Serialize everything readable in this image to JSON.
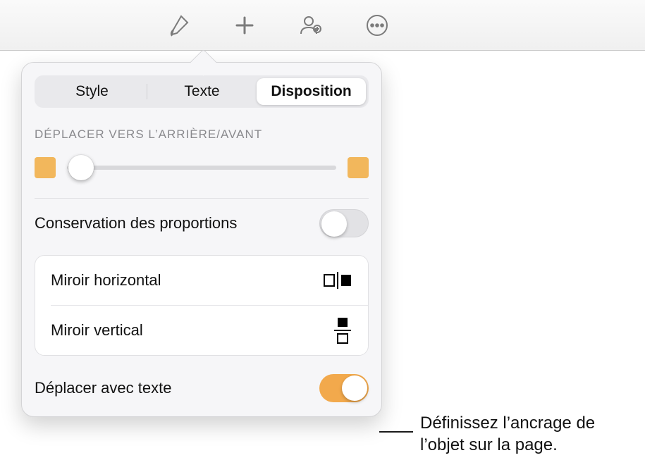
{
  "toolbar": {
    "brush_icon": "brush-icon",
    "plus_icon": "plus-icon",
    "collab_icon": "collaborate-icon",
    "more_icon": "more-icon"
  },
  "tabs": {
    "style": "Style",
    "text": "Texte",
    "disposition": "Disposition",
    "selected": "disposition"
  },
  "sections": {
    "move_header": "DÉPLACER VERS L’ARRIÈRE/AVANT"
  },
  "rows": {
    "constrain_label": "Conservation des proportions",
    "mirror_h_label": "Miroir horizontal",
    "mirror_v_label": "Miroir vertical",
    "move_with_text_label": "Déplacer avec texte"
  },
  "toggles": {
    "constrain_on": false,
    "move_with_text_on": true
  },
  "callout": {
    "text": "Définissez l’ancrage de l’objet sur la page."
  },
  "colors": {
    "accent": "#f2a94c",
    "slider_box": "#f2b75c"
  }
}
